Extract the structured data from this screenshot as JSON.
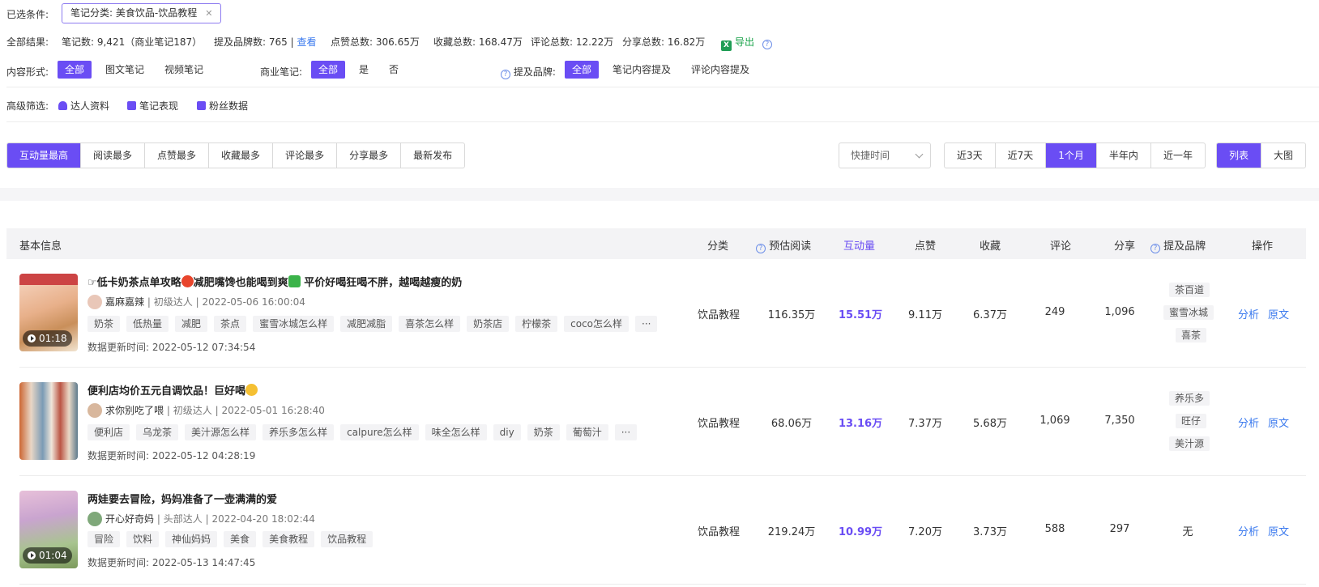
{
  "selected": {
    "label": "已选条件:",
    "chip": "笔记分类: 美食饮品-饮品教程"
  },
  "summary": {
    "label": "全部结果:",
    "notes": "笔记数: 9,421（商业笔记187）",
    "brands": "提及品牌数: 765",
    "view": "查看",
    "likes": "点赞总数: 306.65万",
    "collects": "收藏总数: 168.47万",
    "comments": "评论总数: 12.22万",
    "shares": "分享总数: 16.82万",
    "export": "导出"
  },
  "filters": {
    "content_label": "内容形式:",
    "content_options": [
      "全部",
      "图文笔记",
      "视频笔记"
    ],
    "biz_label": "商业笔记:",
    "biz_options": [
      "全部",
      "是",
      "否"
    ],
    "brand_label": "提及品牌:",
    "brand_options": [
      "全部",
      "笔记内容提及",
      "评论内容提及"
    ]
  },
  "advanced": {
    "label": "高级筛选:",
    "items": [
      "达人资料",
      "笔记表现",
      "粉丝数据"
    ]
  },
  "sort_tabs": [
    "互动量最高",
    "阅读最多",
    "点赞最多",
    "收藏最多",
    "评论最多",
    "分享最多",
    "最新发布"
  ],
  "quick_time": "快捷时间",
  "time_tabs": [
    "近3天",
    "近7天",
    "1个月",
    "半年内",
    "近一年"
  ],
  "view_tabs": [
    "列表",
    "大图"
  ],
  "table": {
    "headers": {
      "basic": "基本信息",
      "category": "分类",
      "reads": "预估阅读",
      "interaction": "互动量",
      "likes": "点赞",
      "collects": "收藏",
      "comments": "评论",
      "shares": "分享",
      "brands": "提及品牌",
      "ops": "操作"
    },
    "updated_label": "数据更新时间:",
    "rows": [
      {
        "title_a": "低卡奶茶点单攻略",
        "title_b": "减肥嘴馋也能喝到爽",
        "title_c": "平价好喝狂喝不胖，越喝越瘦的奶",
        "author": "嘉麻嘉辣",
        "level": "初级达人",
        "date": "2022-05-06 16:00:04",
        "tags": [
          "奶茶",
          "低热量",
          "减肥",
          "茶点",
          "蜜雪冰城怎么样",
          "减肥减脂",
          "喜茶怎么样",
          "奶茶店",
          "柠檬茶",
          "coco怎么样",
          "···"
        ],
        "updated": "2022-05-12 07:34:54",
        "duration": "01:18",
        "category": "饮品教程",
        "reads": "116.35万",
        "interaction": "15.51万",
        "likes": "9.11万",
        "collects": "6.37万",
        "comments": "249",
        "shares": "1,096",
        "brands": [
          "茶百道",
          "蜜雪冰城",
          "喜茶"
        ]
      },
      {
        "title_a": "便利店均价五元自调饮品！巨好喝",
        "author": "求你别吃了喂",
        "level": "初级达人",
        "date": "2022-05-01 16:28:40",
        "tags": [
          "便利店",
          "乌龙茶",
          "美汁源怎么样",
          "养乐多怎么样",
          "calpure怎么样",
          "味全怎么样",
          "diy",
          "奶茶",
          "葡萄汁",
          "···"
        ],
        "updated": "2022-05-12 04:28:19",
        "category": "饮品教程",
        "reads": "68.06万",
        "interaction": "13.16万",
        "likes": "7.37万",
        "collects": "5.68万",
        "comments": "1,069",
        "shares": "7,350",
        "brands": [
          "养乐多",
          "旺仔",
          "美汁源"
        ]
      },
      {
        "title_a": "两娃要去冒险，妈妈准备了一壶满满的爱",
        "author": "开心好奇妈",
        "level": "头部达人",
        "date": "2022-04-20 18:02:44",
        "tags": [
          "冒险",
          "饮料",
          "神仙妈妈",
          "美食",
          "美食教程",
          "饮品教程"
        ],
        "updated": "2022-05-13 14:47:45",
        "duration": "01:04",
        "category": "饮品教程",
        "reads": "219.24万",
        "interaction": "10.99万",
        "likes": "7.20万",
        "collects": "3.73万",
        "comments": "588",
        "shares": "297",
        "brands_none": "无"
      }
    ],
    "ops": {
      "analyze": "分析",
      "original": "原文"
    }
  },
  "colors": {
    "accent": "#6a4df4",
    "link": "#3a79ee",
    "export": "#1aa34a"
  }
}
